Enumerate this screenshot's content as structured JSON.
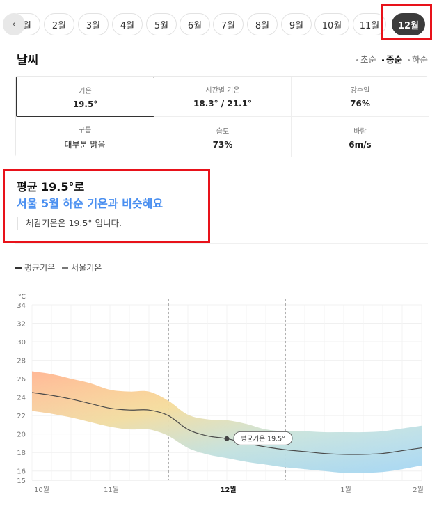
{
  "months": [
    {
      "label": "월"
    },
    {
      "label": "2월"
    },
    {
      "label": "3월"
    },
    {
      "label": "4월"
    },
    {
      "label": "5월"
    },
    {
      "label": "6월"
    },
    {
      "label": "7월"
    },
    {
      "label": "8월"
    },
    {
      "label": "9월"
    },
    {
      "label": "10월"
    },
    {
      "label": "11월"
    },
    {
      "label": "12월",
      "active": true
    }
  ],
  "nav": {
    "prev_icon": "chevron-left-icon",
    "prev_glyph": "‹"
  },
  "weather": {
    "title": "날씨",
    "periods": [
      "초순",
      "중순",
      "하순"
    ],
    "active_period": "중순"
  },
  "stats": [
    {
      "label": "기온",
      "value": "19.5°",
      "selected": true
    },
    {
      "label": "시간별 기온",
      "value": "18.3° / 21.1°"
    },
    {
      "label": "강수일",
      "value": "76%"
    },
    {
      "label": "구름",
      "value": "대부분 맑음"
    },
    {
      "label": "습도",
      "value": "73%"
    },
    {
      "label": "바람",
      "value": "6m/s"
    }
  ],
  "summary": {
    "title": "평균 19.5°로",
    "subtitle": "서울 5월 하순 기온과 비슷해요",
    "note": "체감기온은 19.5° 입니다."
  },
  "legend": {
    "avg": "평균기온",
    "seoul": "서울기온"
  },
  "accent_colors": {
    "highlight": "#e8121a",
    "link": "#4a8ff0",
    "active_pill": "#3c3c3c"
  },
  "chart_data": {
    "type": "area",
    "ylabel": "°C",
    "ylim": [
      15,
      34
    ],
    "y_ticks": [
      34,
      32,
      30,
      28,
      26,
      24,
      22,
      20,
      18,
      16,
      15
    ],
    "x_ticks": [
      "10월",
      "11월",
      "12월",
      "1월",
      "2월"
    ],
    "x_ticks_bold": "12월",
    "x": [
      0,
      0.05,
      0.1,
      0.15,
      0.2,
      0.25,
      0.3,
      0.35,
      0.4,
      0.45,
      0.5,
      0.55,
      0.6,
      0.65,
      0.7,
      0.75,
      0.8,
      0.85,
      0.9,
      0.95,
      1.0
    ],
    "series": [
      {
        "name": "평균기온",
        "values": [
          24.5,
          24.2,
          23.8,
          23.3,
          22.8,
          22.6,
          22.6,
          22.0,
          20.5,
          19.8,
          19.5,
          19.0,
          18.6,
          18.3,
          18.1,
          17.9,
          17.8,
          17.8,
          17.9,
          18.2,
          18.5
        ]
      },
      {
        "name": "upper",
        "values": [
          26.8,
          26.5,
          26.0,
          25.5,
          24.8,
          24.6,
          24.6,
          23.6,
          22.1,
          21.6,
          21.5,
          21.1,
          20.5,
          20.3,
          20.3,
          20.2,
          20.2,
          20.2,
          20.3,
          20.6,
          20.9
        ]
      },
      {
        "name": "lower",
        "values": [
          22.5,
          22.2,
          21.8,
          21.3,
          20.8,
          20.5,
          20.5,
          19.8,
          18.5,
          17.8,
          17.4,
          17.0,
          16.7,
          16.4,
          16.2,
          16.0,
          15.8,
          15.8,
          15.9,
          16.2,
          16.6
        ]
      }
    ],
    "marker": {
      "x": 0.5,
      "y": 19.5,
      "label": "평균기온 19.5°"
    },
    "period_lines": [
      0.35,
      0.65
    ]
  }
}
